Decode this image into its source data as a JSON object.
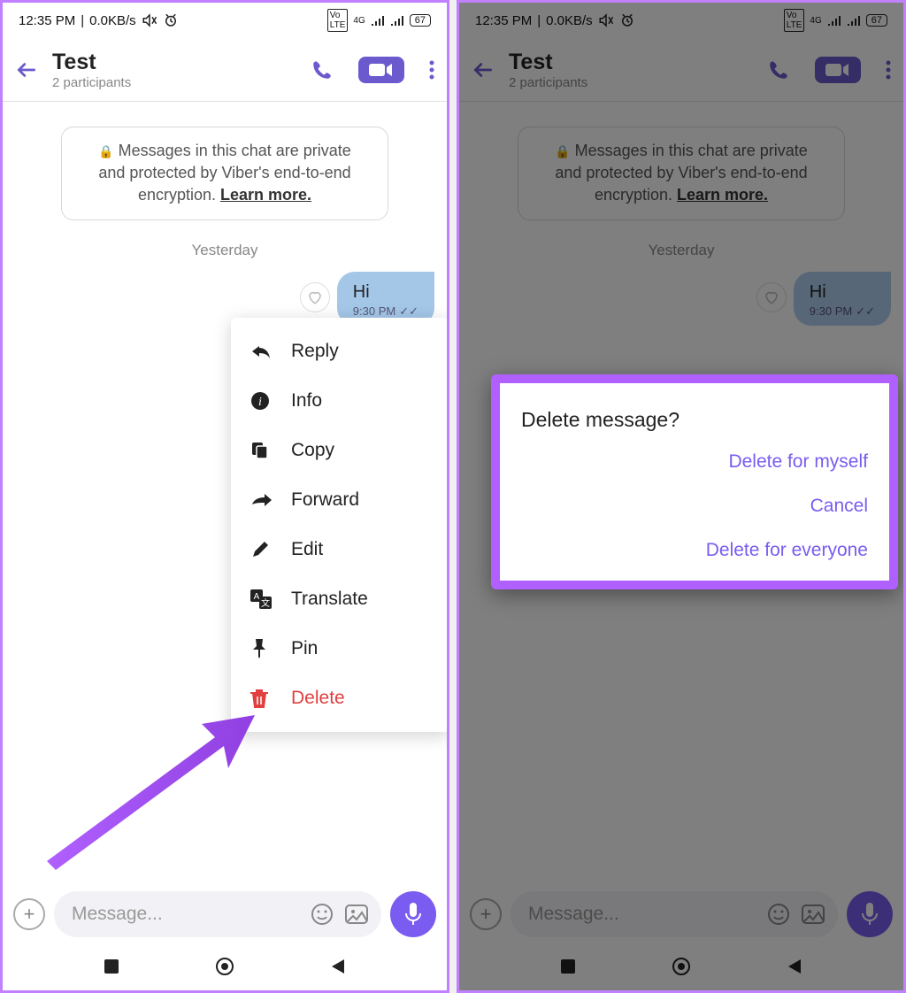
{
  "status": {
    "time": "12:35 PM",
    "net": "0.0KB/s",
    "battery": "67"
  },
  "header": {
    "title": "Test",
    "subtitle": "2 participants"
  },
  "privacy": {
    "text_pre": "Messages in this chat are private and protected by Viber's end-to-end encryption. ",
    "learn": "Learn more."
  },
  "date_separator": "Yesterday",
  "message": {
    "text": "Hi",
    "time": "9:30 PM"
  },
  "context_menu": {
    "reply": "Reply",
    "info": "Info",
    "copy": "Copy",
    "forward": "Forward",
    "edit": "Edit",
    "translate": "Translate",
    "pin": "Pin",
    "delete": "Delete"
  },
  "input": {
    "placeholder": "Message..."
  },
  "dialog": {
    "title": "Delete message?",
    "delete_myself": "Delete for myself",
    "cancel": "Cancel",
    "delete_everyone": "Delete for everyone"
  }
}
